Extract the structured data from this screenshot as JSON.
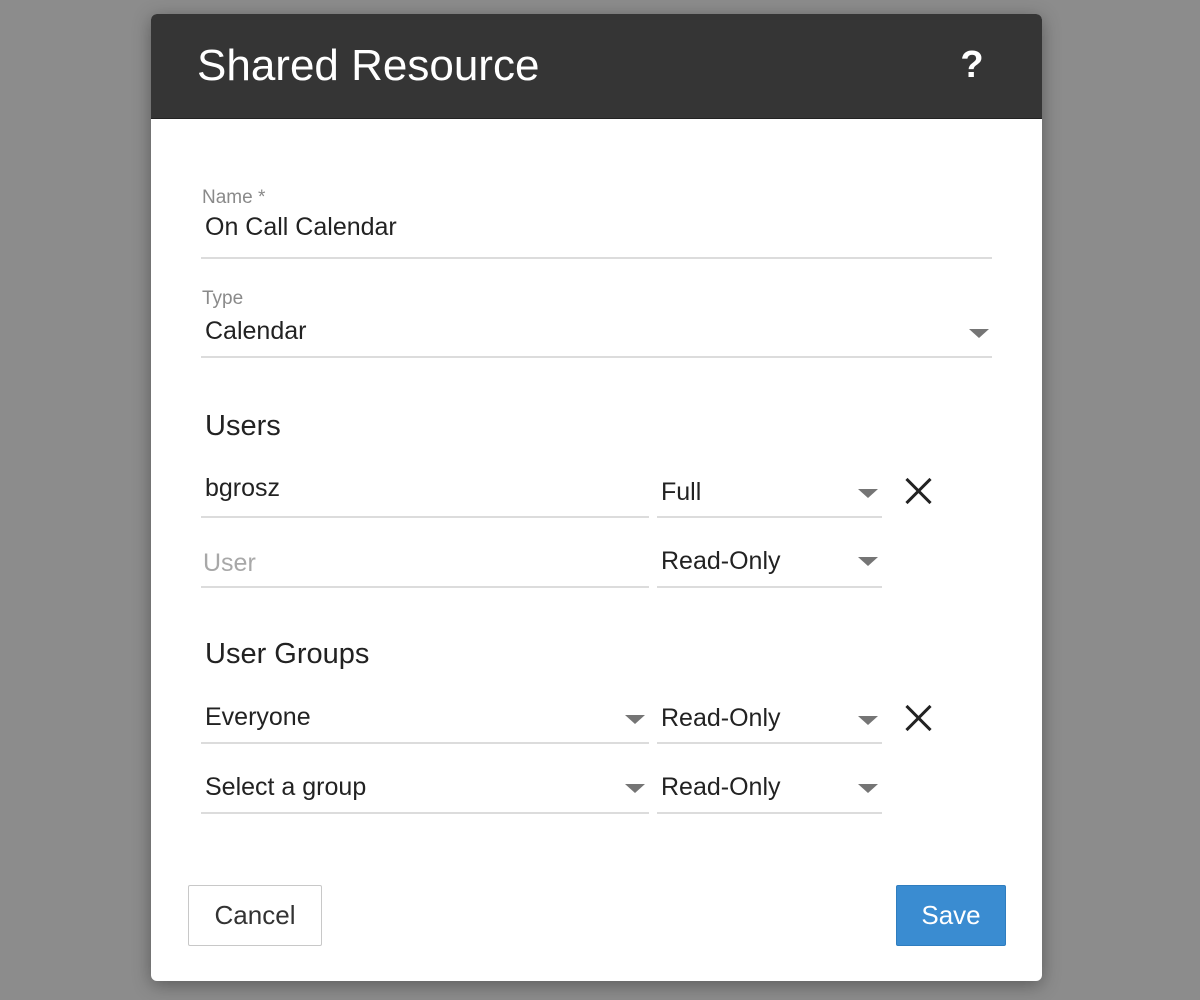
{
  "dialog": {
    "title": "Shared Resource",
    "help_glyph": "?"
  },
  "form": {
    "name": {
      "label": "Name *",
      "value": "On Call Calendar"
    },
    "type": {
      "label": "Type",
      "value": "Calendar"
    }
  },
  "users": {
    "title": "Users",
    "rows": [
      {
        "user": "bgrosz",
        "permission": "Full",
        "removable": true
      },
      {
        "user_placeholder": "User",
        "permission": "Read-Only",
        "removable": false
      }
    ]
  },
  "user_groups": {
    "title": "User Groups",
    "rows": [
      {
        "group": "Everyone",
        "permission": "Read-Only",
        "removable": true
      },
      {
        "group": "Select a group",
        "permission": "Read-Only",
        "removable": false
      }
    ]
  },
  "actions": {
    "cancel_label": "Cancel",
    "save_label": "Save"
  },
  "colors": {
    "header_bg": "#353535",
    "primary": "#3a8cd1",
    "backdrop": "#8c8c8c"
  }
}
